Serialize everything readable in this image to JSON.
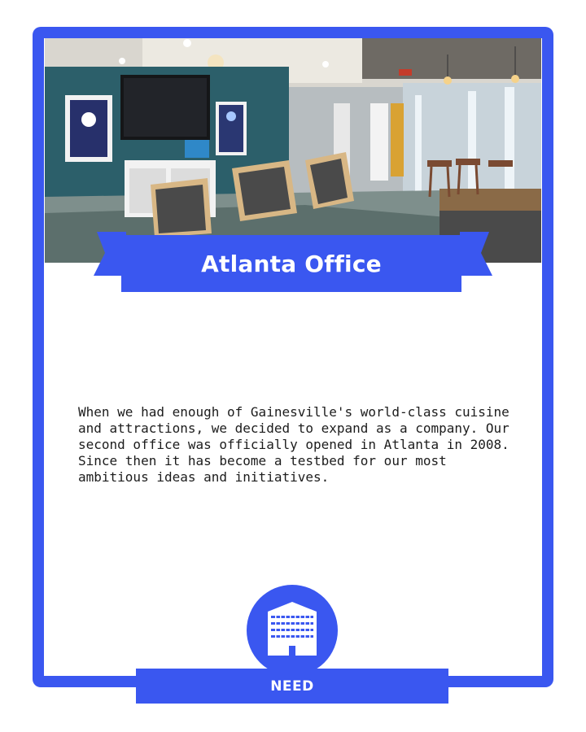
{
  "card": {
    "title": "Atlanta Office",
    "description": "When we had enough of Gainesville's world-class cuisine and attractions, we decided to expand as a company. Our second office was officially opened in Atlanta in 2008. Since then it has become a testbed for our most ambitious ideas and initiatives.",
    "footer_label": "NEED",
    "emblem_icon": "office-building-icon",
    "accent_color": "#3a57f0"
  }
}
